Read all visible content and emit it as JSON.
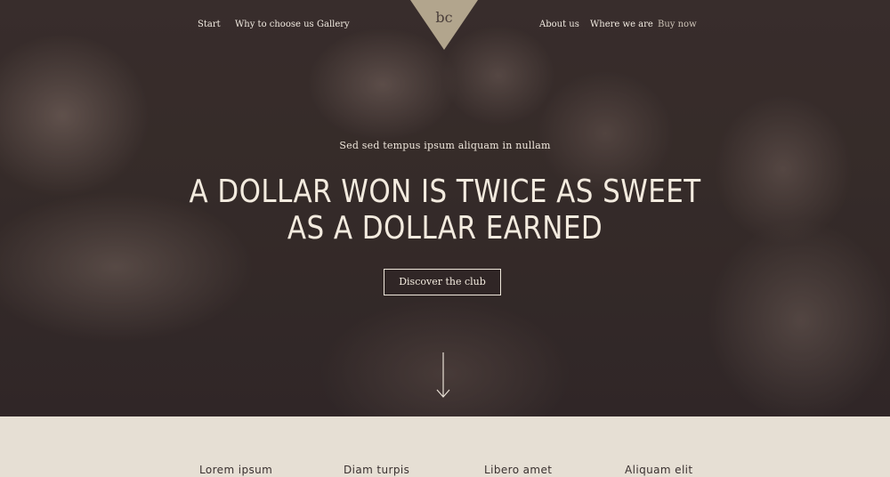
{
  "nav": {
    "left_items": [
      "Start",
      "Why to choose us",
      "Gallery"
    ],
    "right_items": [
      "About us",
      "Where we are",
      "Buy now"
    ],
    "logo_text": "bc"
  },
  "hero": {
    "tagline": "Sed sed tempus ipsum aliquam in nullam",
    "headline_line1": "A DOLLAR WON IS TWICE AS SWEET",
    "headline_line2": "AS A DOLLAR EARNED",
    "cta_label": "Discover the club",
    "scroll_icon": "arrow-down-icon"
  },
  "features": {
    "titles": [
      "Lorem ipsum",
      "Diam turpis",
      "Libero amet",
      "Aliquam elit"
    ]
  },
  "colors": {
    "hero_overlay": "#3a2f2c",
    "text_light": "#f3ebdf",
    "logo_gold": "#b2a58d",
    "section_bg": "#e6dfd4",
    "section_text": "#3a3130"
  }
}
